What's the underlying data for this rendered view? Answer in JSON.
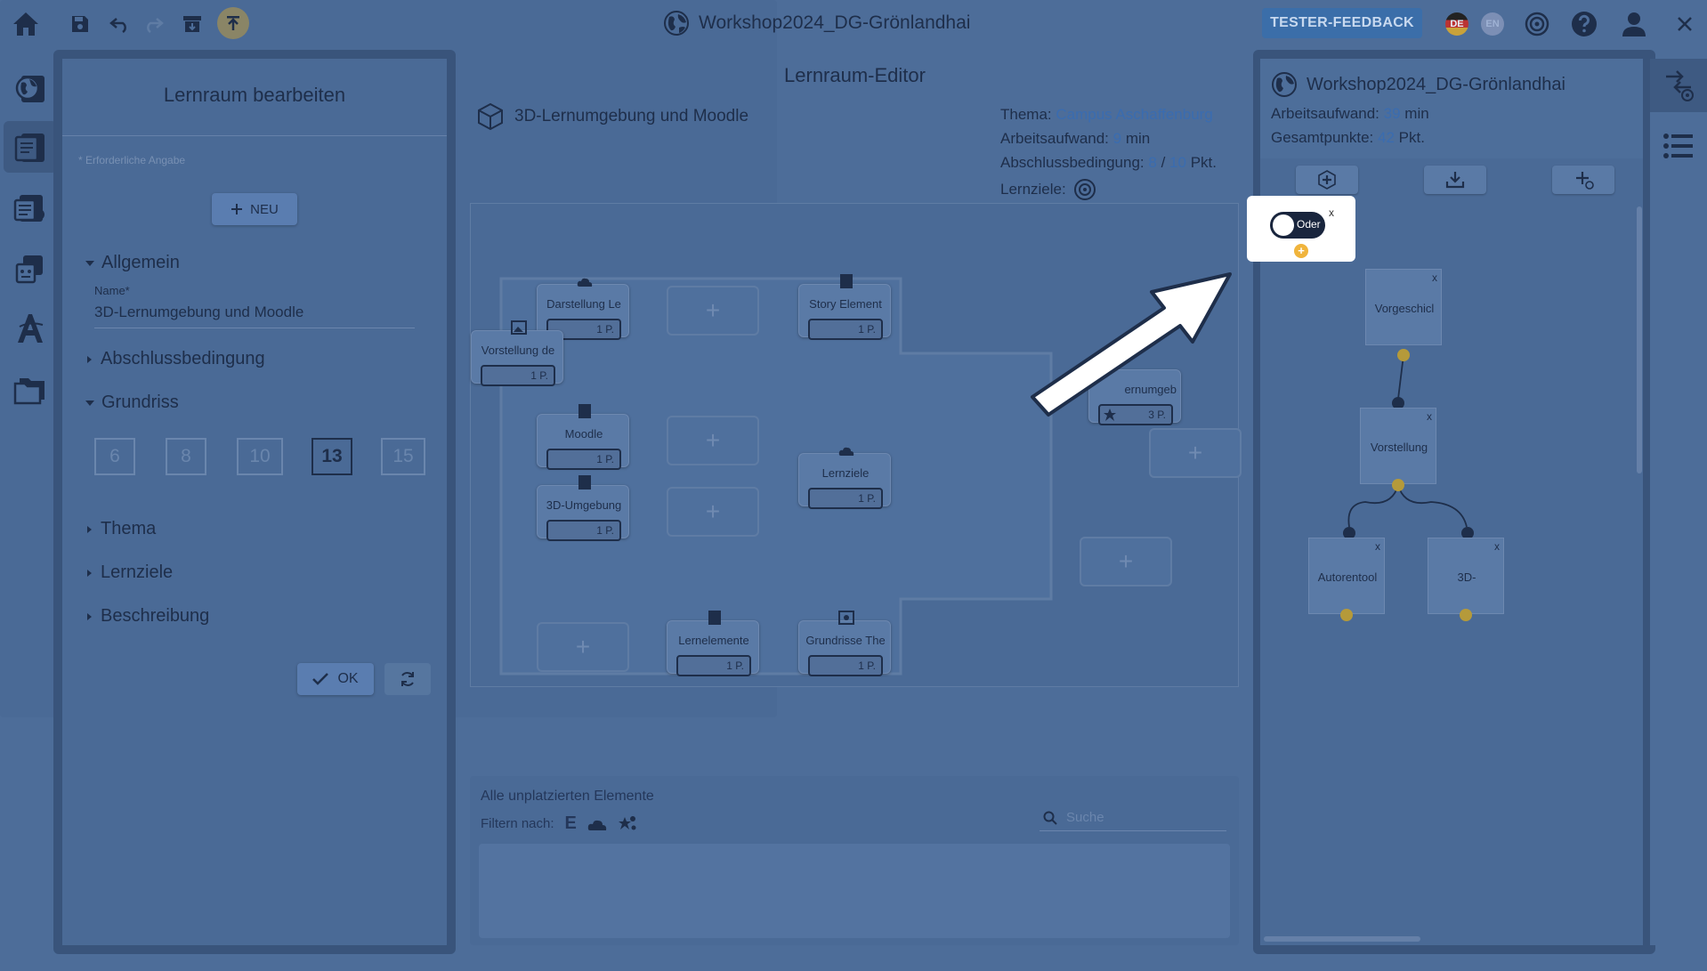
{
  "app": {
    "title": "Workshop2024_DG-Grönlandhai",
    "feedback_button": "TESTER-FEEDBACK",
    "lang_de": "DE",
    "lang_en": "EN"
  },
  "left_panel": {
    "title": "Lernraum bearbeiten",
    "required_note": "* Erforderliche Angabe",
    "new_button": "NEU",
    "sections": {
      "allgemein": "Allgemein",
      "abschluss": "Abschlussbedingung",
      "grundriss": "Grundriss",
      "thema": "Thema",
      "lernziele": "Lernziele",
      "beschreibung": "Beschreibung"
    },
    "name_label": "Name*",
    "name_value": "3D-Lernumgebung und Moodle",
    "floorplans": [
      "6",
      "8",
      "10",
      "13",
      "15"
    ],
    "selected_floorplan": "13",
    "ok_button": "OK"
  },
  "editor": {
    "title": "Lernraum-Editor",
    "space_name": "3D-Lernumgebung und Moodle",
    "theme_label": "Thema:",
    "theme_value": "Campus Aschaffenburg",
    "workload_label": "Arbeitsaufwand:",
    "workload_value": "9",
    "workload_unit": "min",
    "condition_label": "Abschlussbedingung:",
    "condition_value": "8",
    "condition_sep": "/",
    "condition_total": "10",
    "condition_unit": "Pkt.",
    "goals_label": "Lernziele:",
    "slot_plus": "+",
    "elements": [
      {
        "name": "Darstellung Le",
        "points": "1 P."
      },
      {
        "name": "Story Element",
        "points": "1 P."
      },
      {
        "name": "Vorstellung de",
        "points": "1 P."
      },
      {
        "name": "ernumgeb",
        "points": "3 P."
      },
      {
        "name": "Moodle",
        "points": "1 P."
      },
      {
        "name": "3D-Umgebung",
        "points": "1 P."
      },
      {
        "name": "Lernziele",
        "points": "1 P."
      },
      {
        "name": "Lernelemente",
        "points": "1 P."
      },
      {
        "name": "Grundrisse The",
        "points": "1 P."
      }
    ]
  },
  "unplaced": {
    "title": "Alle unplatzierten Elemente",
    "filter_label": "Filtern nach:",
    "filter_e": "E",
    "search_placeholder": "Suche"
  },
  "right_panel": {
    "title": "Workshop2024_DG-Grönlandhai",
    "workload_label": "Arbeitsaufwand:",
    "workload_value": "39",
    "workload_unit": "min",
    "points_label": "Gesamtpunkte:",
    "points_value": "42",
    "points_unit": "Pkt.",
    "close_x": "x",
    "nodes": [
      {
        "label": "Vorgeschicl"
      },
      {
        "label": "Vorstellung"
      },
      {
        "label": "Autorentool"
      },
      {
        "label": "3D-"
      }
    ]
  },
  "highlight": {
    "toggle_label": "Oder",
    "close": "x",
    "add": "+"
  },
  "colors": {
    "overlay_bg": "#4d6d99",
    "accent": "#3a6cb0",
    "dark": "#1e2e4a",
    "highlight": "#ffffff",
    "feedback": "#3b6ea9"
  }
}
